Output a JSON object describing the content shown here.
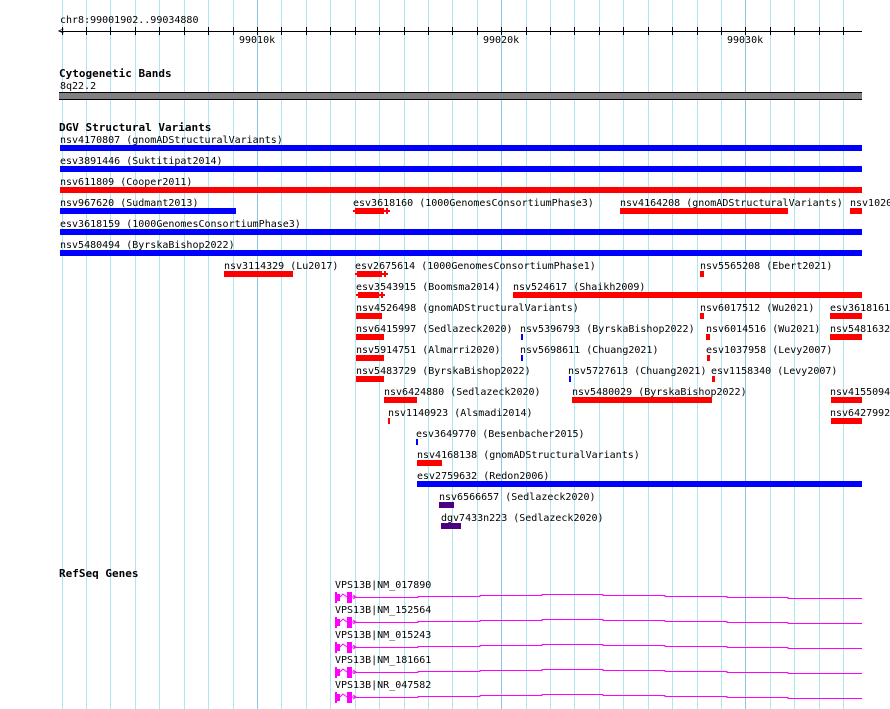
{
  "ruler": {
    "location": "chr8:99001902..99034880",
    "tick_labels": [
      "99010k",
      "99020k",
      "99030k"
    ]
  },
  "cytobands": {
    "title": "Cytogenetic Bands",
    "band": "8q22.2"
  },
  "dgv": {
    "title": "DGV Structural Variants",
    "features": [
      {
        "label": "nsv4170807 (gnomADStructuralVariants)",
        "type": "gain"
      },
      {
        "label": "esv3891446 (Suktitipat2014)",
        "type": "gain"
      },
      {
        "label": "nsv611809 (Cooper2011)",
        "type": "loss"
      },
      {
        "label": "nsv967620 (Sudmant2013)",
        "type": "gain"
      },
      {
        "label": "esv3618160 (1000GenomesConsortiumPhase3)",
        "type": "loss"
      },
      {
        "label": "nsv4164208 (gnomADStructuralVariants)",
        "type": "loss"
      },
      {
        "label": "nsv1020",
        "type": "loss"
      },
      {
        "label": "esv3618159 (1000GenomesConsortiumPhase3)",
        "type": "gain"
      },
      {
        "label": "nsv5480494 (ByrskaBishop2022)",
        "type": "gain"
      },
      {
        "label": "nsv3114329 (Lu2017)",
        "type": "loss"
      },
      {
        "label": "esv2675614 (1000GenomesConsortiumPhase1)",
        "type": "loss"
      },
      {
        "label": "nsv5565208 (Ebert2021)",
        "type": "loss"
      },
      {
        "label": "esv3543915 (Boomsma2014)",
        "type": "loss"
      },
      {
        "label": "nsv524617 (Shaikh2009)",
        "type": "loss"
      },
      {
        "label": "nsv4526498 (gnomADStructuralVariants)",
        "type": "loss"
      },
      {
        "label": "nsv6017512 (Wu2021)",
        "type": "loss"
      },
      {
        "label": "esv3618161",
        "type": "loss"
      },
      {
        "label": "nsv6415997 (Sedlazeck2020)",
        "type": "loss"
      },
      {
        "label": "nsv5396793 (ByrskaBishop2022)",
        "type": "gain"
      },
      {
        "label": "nsv6014516 (Wu2021)",
        "type": "loss"
      },
      {
        "label": "nsv5481632",
        "type": "loss"
      },
      {
        "label": "nsv5914751 (Almarri2020)",
        "type": "loss"
      },
      {
        "label": "nsv5698611 (Chuang2021)",
        "type": "gain"
      },
      {
        "label": "esv1037958 (Levy2007)",
        "type": "loss"
      },
      {
        "label": "nsv5483729 (ByrskaBishop2022)",
        "type": "loss"
      },
      {
        "label": "nsv5727613 (Chuang2021)",
        "type": "gain"
      },
      {
        "label": "esv1158340 (Levy2007)",
        "type": "loss"
      },
      {
        "label": "nsv6424880 (Sedlazeck2020)",
        "type": "loss"
      },
      {
        "label": "nsv5480029 (ByrskaBishop2022)",
        "type": "loss"
      },
      {
        "label": "nsv4155094",
        "type": "loss"
      },
      {
        "label": "nsv1140923 (Alsmadi2014)",
        "type": "loss"
      },
      {
        "label": "nsv6427992",
        "type": "loss"
      },
      {
        "label": "esv3649770 (Besenbacher2015)",
        "type": "gain"
      },
      {
        "label": "nsv4168138 (gnomADStructuralVariants)",
        "type": "loss"
      },
      {
        "label": "esv2759632 (Redon2006)",
        "type": "gain"
      },
      {
        "label": "nsv6566657 (Sedlazeck2020)",
        "type": "complex"
      },
      {
        "label": "dgv7433n223 (Sedlazeck2020)",
        "type": "complex"
      }
    ]
  },
  "colors": {
    "gain": "#0000ff",
    "loss": "#ff0000",
    "complex": "#4b0082",
    "gene": "#ff00ff",
    "band": "#808080"
  },
  "refseq": {
    "title": "RefSeq Genes",
    "genes": [
      {
        "label": "VPS13B|NM_017890"
      },
      {
        "label": "VPS13B|NM_152564"
      },
      {
        "label": "VPS13B|NM_015243"
      },
      {
        "label": "VPS13B|NM_181661"
      },
      {
        "label": "VPS13B|NR_047582"
      }
    ]
  }
}
